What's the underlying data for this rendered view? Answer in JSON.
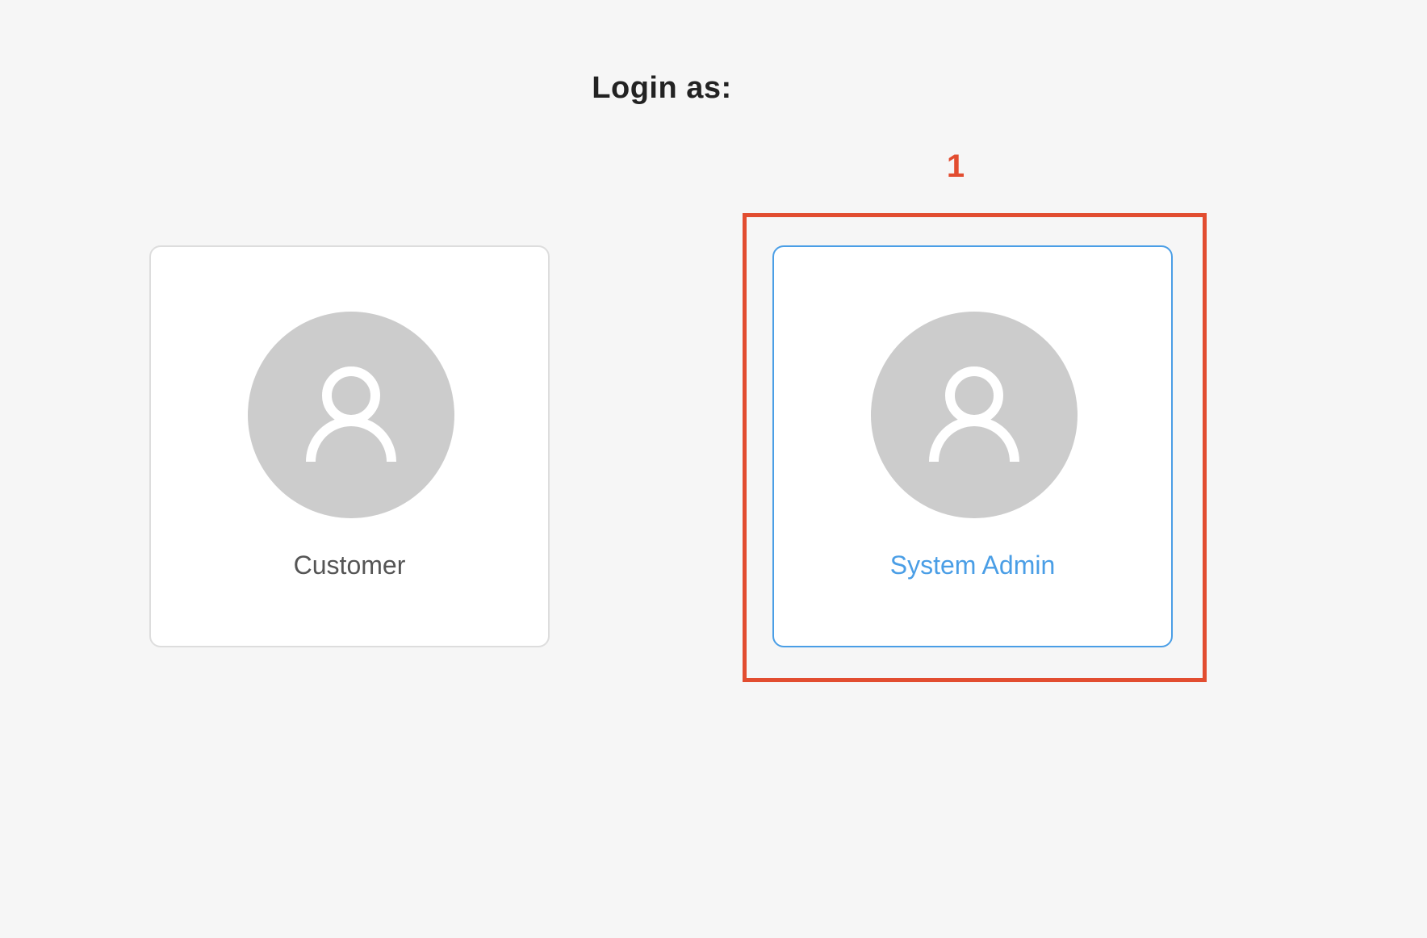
{
  "page": {
    "title": "Login as:"
  },
  "roles": [
    {
      "label": "Customer",
      "icon": "user-icon",
      "selected": false
    },
    {
      "label": "System Admin",
      "icon": "user-icon",
      "selected": true
    }
  ],
  "annotation": {
    "number": "1",
    "color": "#e24d30"
  },
  "colors": {
    "accent": "#4a9ee6",
    "avatar_background": "#cccccc",
    "page_background": "#f6f6f6"
  }
}
